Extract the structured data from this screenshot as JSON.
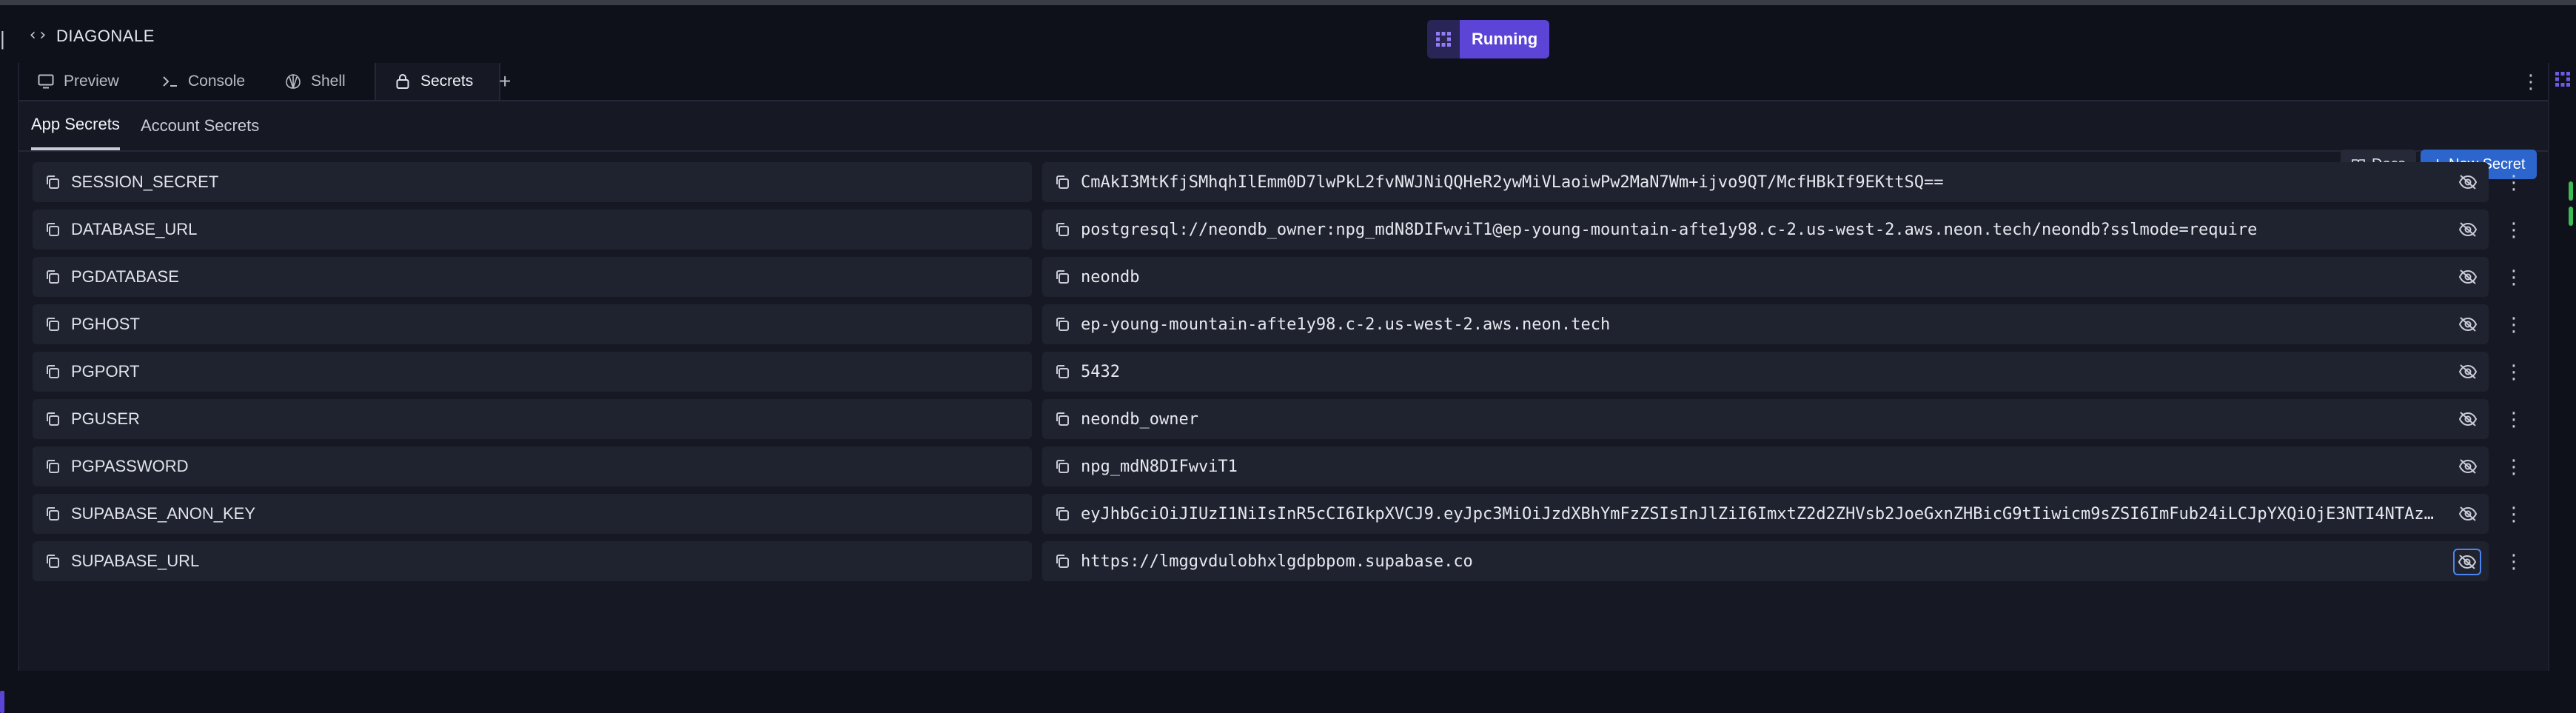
{
  "app": {
    "name": "DIAGONALE",
    "run_label": "Running"
  },
  "tabs": [
    {
      "label": "Preview",
      "icon": "monitor-icon"
    },
    {
      "label": "Console",
      "icon": "terminal-icon"
    },
    {
      "label": "Shell",
      "icon": "shell-icon"
    },
    {
      "label": "Secrets",
      "icon": "lock-icon",
      "active": true
    }
  ],
  "subtabs": [
    {
      "label": "App Secrets",
      "active": true
    },
    {
      "label": "Account Secrets"
    }
  ],
  "actions": {
    "docs_label": "Docs",
    "new_secret_label": "New Secret"
  },
  "secrets": [
    {
      "key": "SESSION_SECRET",
      "value": "CmAkI3MtKfjSMhqhIlEmm0D7lwPkL2fvNWJNiQQHeR2ywMiVLaoiwPw2MaN7Wm+ijvo9QT/McfHBkIf9EKttSQ=="
    },
    {
      "key": "DATABASE_URL",
      "value": "postgresql://neondb_owner:npg_mdN8DIFwviT1@ep-young-mountain-afte1y98.c-2.us-west-2.aws.neon.tech/neondb?sslmode=require"
    },
    {
      "key": "PGDATABASE",
      "value": "neondb"
    },
    {
      "key": "PGHOST",
      "value": "ep-young-mountain-afte1y98.c-2.us-west-2.aws.neon.tech"
    },
    {
      "key": "PGPORT",
      "value": "5432"
    },
    {
      "key": "PGUSER",
      "value": "neondb_owner"
    },
    {
      "key": "PGPASSWORD",
      "value": "npg_mdN8DIFwviT1"
    },
    {
      "key": "SUPABASE_ANON_KEY",
      "value": "eyJhbGciOiJIUzI1NiIsInR5cCI6IkpXVCJ9.eyJpc3MiOiJzdXBhYmFzZSIsInJlZiI6ImxtZ2d2ZHVsb2JoeGxnZHBicG9tIiwicm9sZSI6ImFub24iLCJpYXQiOjE3NTI4NTAz…"
    },
    {
      "key": "SUPABASE_URL",
      "value": "https://lmggvdulobhxlgdpbpom.supabase.co"
    }
  ],
  "colors": {
    "accent": "#5b44d6",
    "primary_button": "#2c66cd",
    "focus_ring": "#4b86f0"
  }
}
